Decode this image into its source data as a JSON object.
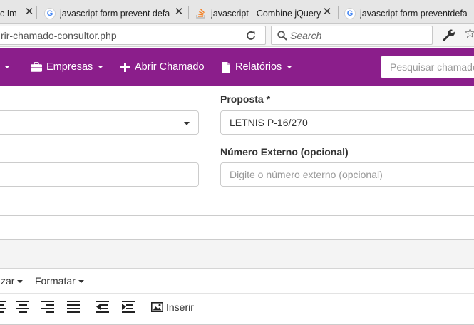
{
  "browser": {
    "tabs": [
      {
        "title": "c Im",
        "icon": "image-icon"
      },
      {
        "title": "javascript form prevent defa",
        "icon": "google-icon"
      },
      {
        "title": "javascript - Combine jQuery",
        "icon": "stackoverflow-icon"
      },
      {
        "title": "javascript form preventdefa",
        "icon": "google-icon"
      }
    ],
    "close_glyph": "✕",
    "url": "rir-chamado-consultor.php",
    "search_placeholder": "Search",
    "google_glyph": "G"
  },
  "appbar": {
    "items": [
      {
        "label": "Empresas",
        "icon": "briefcase-icon"
      },
      {
        "label": "Abrir Chamado",
        "icon": "plus-icon"
      },
      {
        "label": "Relatórios",
        "icon": "file-icon"
      }
    ],
    "search_placeholder": "Pesquisar chamado"
  },
  "form": {
    "proposta_label": "Proposta *",
    "proposta_value": "LETNIS P-16/270",
    "numero_label": "Número Externo (opcional)",
    "numero_placeholder": "Digite o número externo (opcional)"
  },
  "editor": {
    "menus": [
      "zar",
      "Formatar"
    ],
    "insert_label": "Inserir"
  },
  "colors": {
    "appbar": "#8b1e8b"
  }
}
